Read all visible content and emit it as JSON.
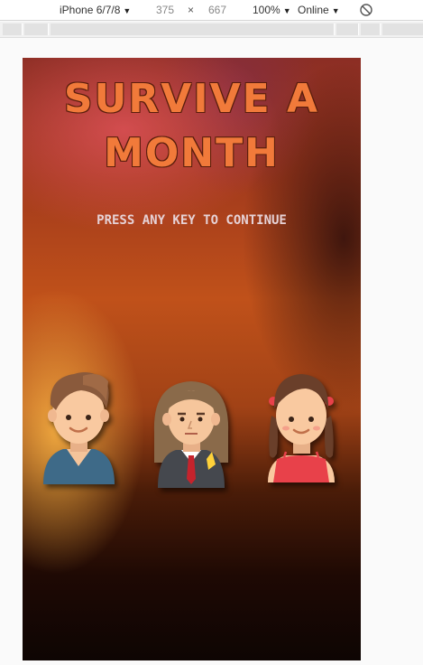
{
  "devtools": {
    "device": "iPhone 6/7/8",
    "width": "375",
    "times": "×",
    "height": "667",
    "zoom": "100%",
    "network": "Online",
    "caret": "▼"
  },
  "game": {
    "title_line1": "SURVIVE A",
    "title_line2": "MONTH",
    "prompt": "PRESS ANY KEY TO CONTINUE",
    "characters": [
      "boy-avatar",
      "businesswoman-avatar",
      "girl-avatar"
    ]
  },
  "colors": {
    "title": "#f17a3a",
    "prompt": "#e6d2d6"
  }
}
